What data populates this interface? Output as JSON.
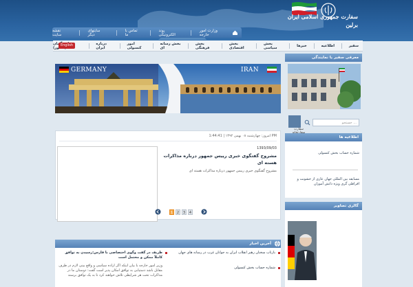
{
  "header": {
    "title_line1": "سفارت جمهوری اسلامی ایران",
    "title_line2": "برلین"
  },
  "top_nav": {
    "items": [
      "نقشه سایت",
      "سایتهای دیگر",
      "تماس با ما",
      "پوند الکترونیکی",
      "وزارت امور خارجه"
    ]
  },
  "main_nav": {
    "items": [
      "سفیر",
      "اطلاعیه",
      "خبرها",
      "بخش سیاسی",
      "بخش اقتصادی",
      "بخش فرهنگی",
      "بخش رسانه ای",
      "امور کنسولی",
      "درباره ایران",
      "درباره آلمان (کشور)"
    ],
    "lang_label": "English"
  },
  "banner": {
    "left_label": "GERMANY",
    "right_label": "IRAN"
  },
  "sidebar": {
    "ambassador_head": "معرفی سفیر یا نمایندگی",
    "search_placeholder": "جستجو ...",
    "thumb_label": "سفارت سفارتخانه",
    "news_head": "اطلاعیه ها",
    "news_items": [
      "شماره حساب بخش کنسولی",
      "مسابقه بین المللی جهان عاری از خشونت و افراطی گری ویژه دانش آموزان"
    ],
    "gallery_head": "گالری تصاویر"
  },
  "main": {
    "date_line": "امروز: چهارشنبه ۰۸ بهمن ۱۳۹۲ | 1:44:41 PM",
    "article_date": "1393/09/03",
    "article_title": "مشروح گفتگوی خبری رییس جمهور درباره مذاکرات هسته ای",
    "article_summary": "مشروح گفتگوی خبری رییس جمهور درباره مذاکرات هسته ای",
    "pages": [
      "1",
      "2",
      "3",
      "4"
    ],
    "active_page": "1"
  },
  "latest": {
    "head": "آخرین اخبار",
    "right_items": [
      "بازتاب سخنان رهبر انقلاب ایران به جوانان غرب در رسانه های جهان",
      "شماره حساب بخش کنسولی"
    ],
    "left_items": [
      "ظریف در گفت وگوی اختصاصی با فارس:رسیدن به توافق کاملاً ممکن و محتمل است",
      "وزیر امور خارجه با بیان اینکه اگر اراده سیاسی و واقع بینی لازم در طرف مقابل باشد دستیابی به توافق امکان پذیر است گفت: دوستان ما در مذاکرات تحت هر شرایطی تلاش خواهند کرد تا به یک توافق برسند"
    ]
  },
  "colors": {
    "header_bg": "#2a63a0",
    "accent_red": "#c3262b",
    "section_blue": "#5582b6",
    "pager_active": "#f3a84a"
  }
}
